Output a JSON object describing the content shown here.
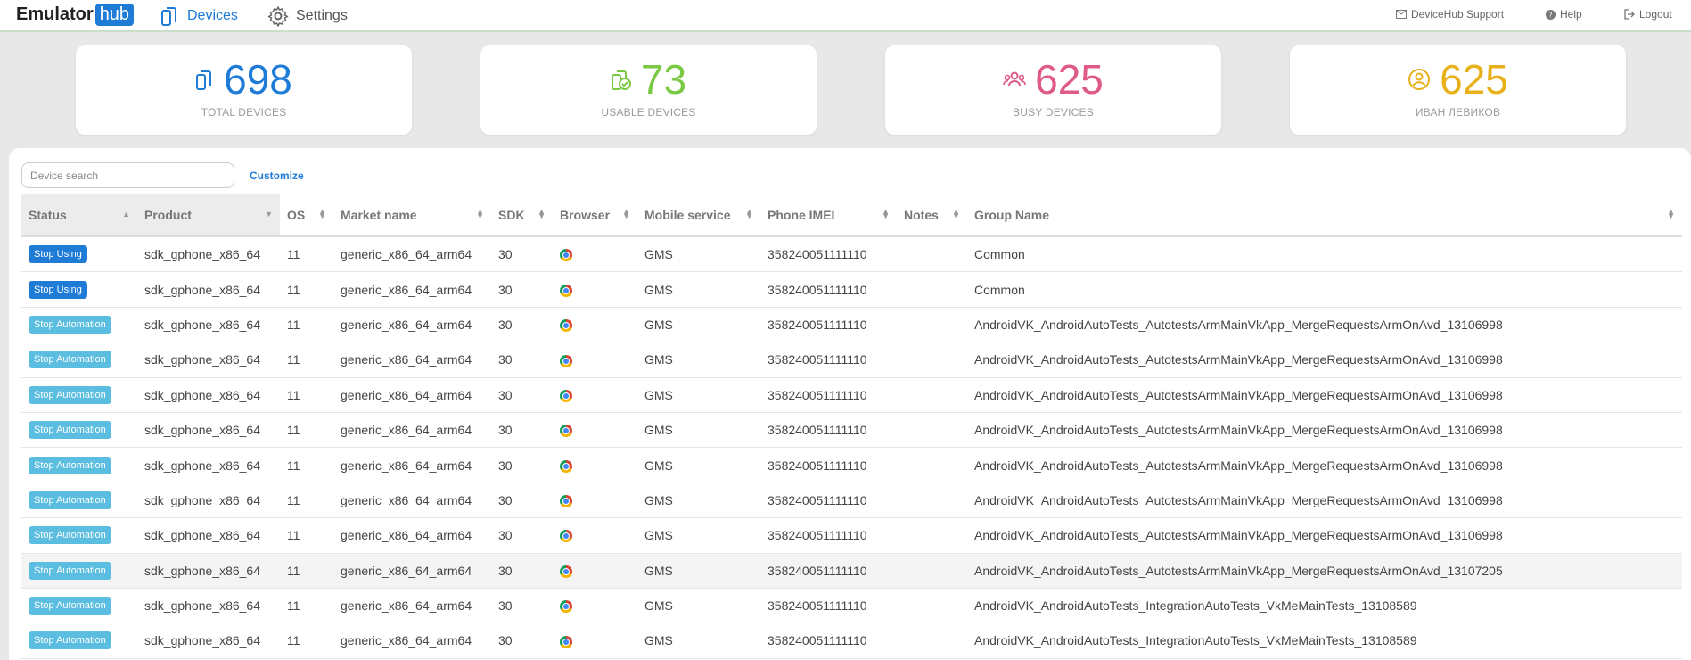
{
  "brand": {
    "name": "Emulator",
    "badge": "hub"
  },
  "nav": {
    "devices": "Devices",
    "settings": "Settings"
  },
  "top_right": {
    "support": "DeviceHub Support",
    "help": "Help",
    "logout": "Logout"
  },
  "stats": [
    {
      "value": "698",
      "label": "TOTAL DEVICES",
      "color": "#1e7bd6"
    },
    {
      "value": "73",
      "label": "USABLE DEVICES",
      "color": "#7ac943"
    },
    {
      "value": "625",
      "label": "BUSY DEVICES",
      "color": "#e05a86"
    },
    {
      "value": "625",
      "label": "ИВАН ЛЕВИКОВ",
      "color": "#e8b11c"
    }
  ],
  "search": {
    "placeholder": "Device search",
    "value": ""
  },
  "customize": "Customize",
  "table": {
    "columns": [
      "Status",
      "Product",
      "OS",
      "Market name",
      "SDK",
      "Browser",
      "Mobile service",
      "Phone IMEI",
      "Notes",
      "Group Name"
    ],
    "rows": [
      {
        "status": "Stop Using",
        "kind": "using",
        "product": "sdk_gphone_x86_64",
        "os": "11",
        "market": "generic_x86_64_arm64",
        "sdk": "30",
        "browser": "chrome-icon",
        "service": "GMS",
        "imei": "358240051111110",
        "notes": "",
        "group": "Common"
      },
      {
        "status": "Stop Using",
        "kind": "using",
        "product": "sdk_gphone_x86_64",
        "os": "11",
        "market": "generic_x86_64_arm64",
        "sdk": "30",
        "browser": "chrome-icon",
        "service": "GMS",
        "imei": "358240051111110",
        "notes": "",
        "group": "Common"
      },
      {
        "status": "Stop Automation",
        "kind": "auto",
        "product": "sdk_gphone_x86_64",
        "os": "11",
        "market": "generic_x86_64_arm64",
        "sdk": "30",
        "browser": "chrome-icon",
        "service": "GMS",
        "imei": "358240051111110",
        "notes": "",
        "group": "AndroidVK_AndroidAutoTests_AutotestsArmMainVkApp_MergeRequestsArmOnAvd_13106998"
      },
      {
        "status": "Stop Automation",
        "kind": "auto",
        "product": "sdk_gphone_x86_64",
        "os": "11",
        "market": "generic_x86_64_arm64",
        "sdk": "30",
        "browser": "chrome-icon",
        "service": "GMS",
        "imei": "358240051111110",
        "notes": "",
        "group": "AndroidVK_AndroidAutoTests_AutotestsArmMainVkApp_MergeRequestsArmOnAvd_13106998"
      },
      {
        "status": "Stop Automation",
        "kind": "auto",
        "product": "sdk_gphone_x86_64",
        "os": "11",
        "market": "generic_x86_64_arm64",
        "sdk": "30",
        "browser": "chrome-icon",
        "service": "GMS",
        "imei": "358240051111110",
        "notes": "",
        "group": "AndroidVK_AndroidAutoTests_AutotestsArmMainVkApp_MergeRequestsArmOnAvd_13106998"
      },
      {
        "status": "Stop Automation",
        "kind": "auto",
        "product": "sdk_gphone_x86_64",
        "os": "11",
        "market": "generic_x86_64_arm64",
        "sdk": "30",
        "browser": "chrome-icon",
        "service": "GMS",
        "imei": "358240051111110",
        "notes": "",
        "group": "AndroidVK_AndroidAutoTests_AutotestsArmMainVkApp_MergeRequestsArmOnAvd_13106998"
      },
      {
        "status": "Stop Automation",
        "kind": "auto",
        "product": "sdk_gphone_x86_64",
        "os": "11",
        "market": "generic_x86_64_arm64",
        "sdk": "30",
        "browser": "chrome-icon",
        "service": "GMS",
        "imei": "358240051111110",
        "notes": "",
        "group": "AndroidVK_AndroidAutoTests_AutotestsArmMainVkApp_MergeRequestsArmOnAvd_13106998"
      },
      {
        "status": "Stop Automation",
        "kind": "auto",
        "product": "sdk_gphone_x86_64",
        "os": "11",
        "market": "generic_x86_64_arm64",
        "sdk": "30",
        "browser": "chrome-icon",
        "service": "GMS",
        "imei": "358240051111110",
        "notes": "",
        "group": "AndroidVK_AndroidAutoTests_AutotestsArmMainVkApp_MergeRequestsArmOnAvd_13106998"
      },
      {
        "status": "Stop Automation",
        "kind": "auto",
        "product": "sdk_gphone_x86_64",
        "os": "11",
        "market": "generic_x86_64_arm64",
        "sdk": "30",
        "browser": "chrome-icon",
        "service": "GMS",
        "imei": "358240051111110",
        "notes": "",
        "group": "AndroidVK_AndroidAutoTests_AutotestsArmMainVkApp_MergeRequestsArmOnAvd_13106998"
      },
      {
        "status": "Stop Automation",
        "kind": "auto",
        "product": "sdk_gphone_x86_64",
        "os": "11",
        "market": "generic_x86_64_arm64",
        "sdk": "30",
        "browser": "chrome-icon",
        "service": "GMS",
        "imei": "358240051111110",
        "notes": "",
        "group": "AndroidVK_AndroidAutoTests_AutotestsArmMainVkApp_MergeRequestsArmOnAvd_13107205",
        "highlight": true
      },
      {
        "status": "Stop Automation",
        "kind": "auto",
        "product": "sdk_gphone_x86_64",
        "os": "11",
        "market": "generic_x86_64_arm64",
        "sdk": "30",
        "browser": "chrome-icon",
        "service": "GMS",
        "imei": "358240051111110",
        "notes": "",
        "group": "AndroidVK_AndroidAutoTests_IntegrationAutoTests_VkMeMainTests_13108589"
      },
      {
        "status": "Stop Automation",
        "kind": "auto",
        "product": "sdk_gphone_x86_64",
        "os": "11",
        "market": "generic_x86_64_arm64",
        "sdk": "30",
        "browser": "chrome-icon",
        "service": "GMS",
        "imei": "358240051111110",
        "notes": "",
        "group": "AndroidVK_AndroidAutoTests_IntegrationAutoTests_VkMeMainTests_13108589"
      }
    ]
  }
}
